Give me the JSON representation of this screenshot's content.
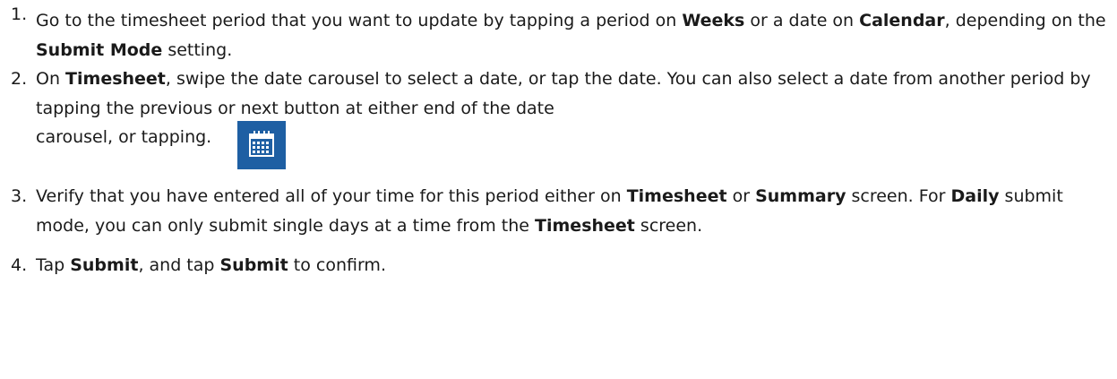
{
  "steps": [
    {
      "num": "1.",
      "parts": [
        {
          "t": "Go to the timesheet period that you want to update by tapping a period on "
        },
        {
          "t": "Weeks",
          "b": true
        },
        {
          "t": " or a date on "
        },
        {
          "t": "Calendar",
          "b": true
        },
        {
          "t": ", depending on the "
        },
        {
          "t": "Submit Mode",
          "b": true
        },
        {
          "t": " setting."
        }
      ]
    },
    {
      "num": "2.",
      "parts": [
        {
          "t": "On "
        },
        {
          "t": "Timesheet",
          "b": true
        },
        {
          "t": ", swipe the date carousel to select a date, or tap the date.  You can also select a date from another period by tapping the previous or next button at either end of the date"
        }
      ],
      "tail": "carousel, or tapping.",
      "icon": "calendar-icon"
    },
    {
      "num": "3.",
      "parts": [
        {
          "t": "Verify that you have entered all of your time for this period either on "
        },
        {
          "t": "Timesheet",
          "b": true
        },
        {
          "t": " or "
        },
        {
          "t": "Summary",
          "b": true
        },
        {
          "t": " screen.  For "
        },
        {
          "t": "Daily",
          "b": true
        },
        {
          "t": " submit mode, you can only submit single days at a time from the "
        },
        {
          "t": "Timesheet",
          "b": true
        },
        {
          "t": " screen."
        }
      ]
    },
    {
      "num": "4.",
      "parts": [
        {
          "t": "Tap "
        },
        {
          "t": "Submit",
          "b": true
        },
        {
          "t": ", and tap "
        },
        {
          "t": "Submit",
          "b": true
        },
        {
          "t": " to confirm."
        }
      ]
    }
  ],
  "colors": {
    "text": "#1a1a1a",
    "icon_bg": "#1e5fa3",
    "icon_fg": "#ffffff"
  }
}
